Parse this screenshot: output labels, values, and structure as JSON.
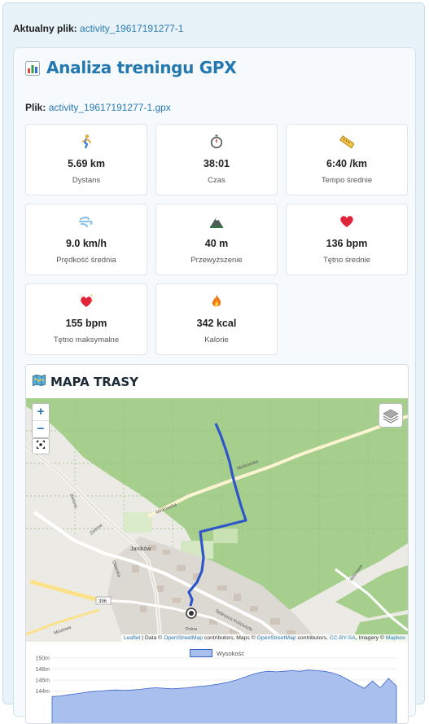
{
  "header": {
    "current_label": "Aktualny plik:",
    "current_file": "activity_19617191277-1"
  },
  "panel": {
    "title": "Analiza treningu GPX",
    "file_label": "Plik:",
    "file_name": "activity_19617191277-1.gpx"
  },
  "stats": [
    {
      "icon": "runner-icon",
      "value": "5.69 km",
      "label": "Dystans"
    },
    {
      "icon": "stopwatch-icon",
      "value": "38:01",
      "label": "Czas"
    },
    {
      "icon": "ruler-icon",
      "value": "6:40 /km",
      "label": "Tempo średnie"
    },
    {
      "icon": "wind-icon",
      "value": "9.0 km/h",
      "label": "Prędkość średnia"
    },
    {
      "icon": "mountain-icon",
      "value": "40 m",
      "label": "Przewyższenie"
    },
    {
      "icon": "heart-icon",
      "value": "136 bpm",
      "label": "Tętno średnie"
    },
    {
      "icon": "sparkling-heart-icon",
      "value": "155 bpm",
      "label": "Tętno maksymalne"
    },
    {
      "icon": "fire-icon",
      "value": "342 kcal",
      "label": "Kalorie"
    }
  ],
  "map": {
    "title": "MAPA TRASY",
    "zoom_in": "+",
    "zoom_out": "−",
    "attribution": {
      "leaflet": "Leaflet",
      "sep1": " | Data © ",
      "osm1": "OpenStreetMap",
      "mid": " contributors, Maps © ",
      "osm2": "OpenStreetMap",
      "mid2": " contributors, ",
      "ccbysa": "CC-BY-SA",
      "mid3": ", Imagery © ",
      "mapbox": "Mapbox"
    },
    "labels": [
      "Minkowska",
      "Minkowska",
      "Zielona",
      "Zielona",
      "Janików",
      "Oławska",
      "396",
      "Tadeusza Kościuszki",
      "Wiśniowa",
      "Miodowa",
      "Polna"
    ]
  },
  "chart_data": {
    "type": "area",
    "legend": "Wysokość",
    "yticks": [
      "150m",
      "148m",
      "146m",
      "144m"
    ],
    "ylim": [
      143,
      150
    ],
    "values": [
      143.0,
      143.1,
      143.3,
      143.5,
      143.7,
      143.9,
      144.0,
      144.1,
      144.2,
      144.1,
      144.2,
      144.3,
      144.5,
      144.6,
      144.5,
      144.4,
      144.5,
      144.6,
      144.8,
      144.9,
      145.1,
      145.3,
      145.6,
      146.0,
      146.5,
      147.0,
      147.4,
      147.6,
      147.5,
      147.6,
      147.7,
      147.6,
      147.8,
      147.7,
      147.6,
      147.3,
      146.8,
      146.0,
      145.2,
      144.5,
      145.8,
      144.6,
      146.3,
      144.9
    ]
  }
}
